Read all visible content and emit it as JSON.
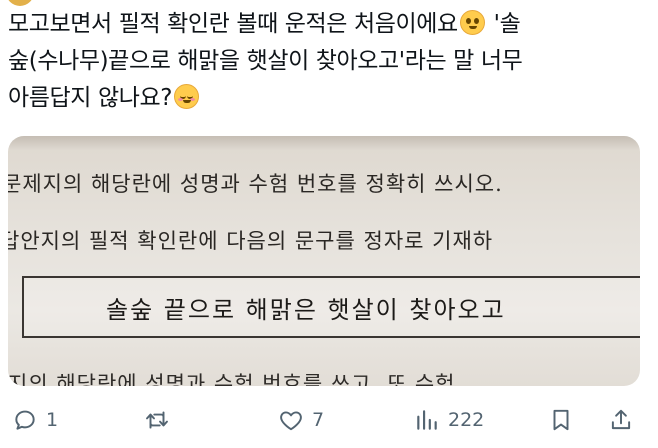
{
  "tweet": {
    "line1": "모고보면서  필적 확인란 볼때 운적은 처음이에요",
    "line1_tail": " '솔",
    "line2": "숲(수나무)끝으로 해맑을 햇살이 찾아오고'라는 말 너무",
    "line3": "아름답지 않나요?",
    "emoji1": "pleading-face-emoji",
    "emoji2": "relieved-face-emoji"
  },
  "photo": {
    "line1": "문제지의 해당란에 성명과 수험 번호를 정확히 쓰시오.",
    "line2": "답안지의 필적 확인란에 다음의 문구를 정자로 기재하",
    "answer": "솔숲 끝으로 해맑은 햇살이 찾아오고",
    "line3": "지의 해당란에 성명과 수험 번호를 쓰고, 또 수험"
  },
  "actions": {
    "reply_count": "1",
    "retweet_count": "",
    "like_count": "7",
    "views_count": "222"
  },
  "colors": {
    "text": "#0f1419",
    "icon": "#536471"
  }
}
